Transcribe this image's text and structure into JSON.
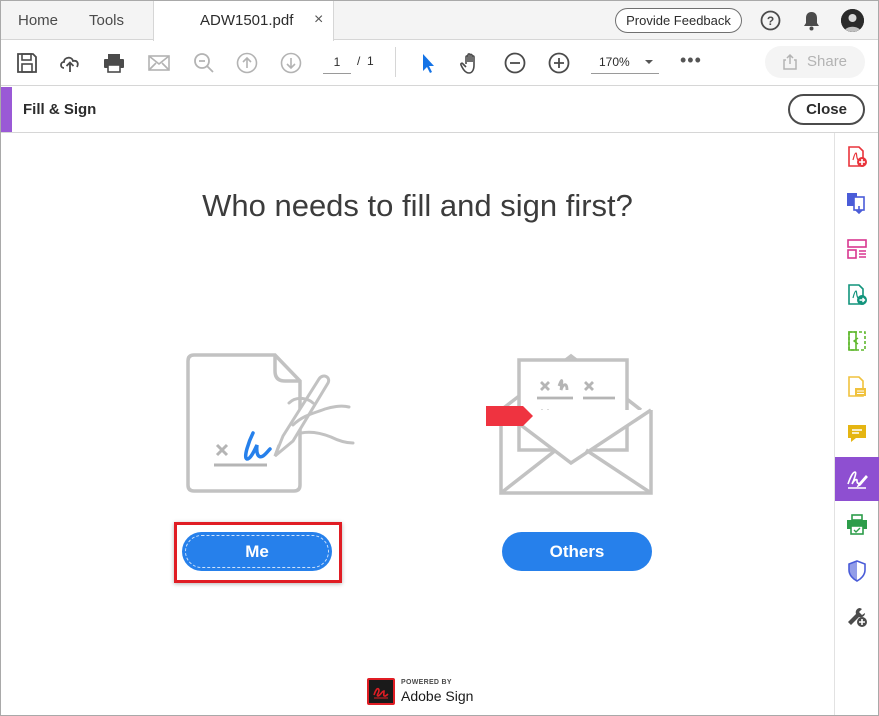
{
  "tabs": {
    "home": "Home",
    "tools": "Tools",
    "document_title": "ADW1501.pdf",
    "close_glyph": "×"
  },
  "header_actions": {
    "feedback_label": "Provide Feedback",
    "help_icon": "help-circle-icon",
    "bell_icon": "bell-icon"
  },
  "toolbar": {
    "icons": [
      "save-icon",
      "cloud-upload-icon",
      "print-icon",
      "email-icon",
      "zoom-search-icon",
      "page-up-icon",
      "page-down-icon",
      "select-pointer-icon",
      "hand-icon",
      "zoom-out-icon",
      "zoom-in-icon",
      "more-icon"
    ],
    "page_current": "1",
    "page_sep": "/",
    "page_total": "1",
    "zoom": "170%",
    "share_label": "Share"
  },
  "panel": {
    "title": "Fill & Sign",
    "close_label": "Close",
    "accent_color": "#9a59d6"
  },
  "main": {
    "question": "Who needs to fill and sign first?",
    "me_label": "Me",
    "others_label": "Others",
    "button_color": "#2680eb",
    "highlight_color": "#e01d24",
    "powered_small": "POWERED BY",
    "powered_brand": "Adobe Sign"
  },
  "rail": {
    "items": [
      "create-pdf-icon",
      "combine-files-icon",
      "organize-pages-icon",
      "export-pdf-icon",
      "edit-pdf-icon",
      "scan-icon",
      "comment-icon",
      "fill-sign-icon",
      "print-production-icon",
      "protect-icon",
      "more-tools-icon"
    ],
    "active": "fill-sign-icon"
  }
}
